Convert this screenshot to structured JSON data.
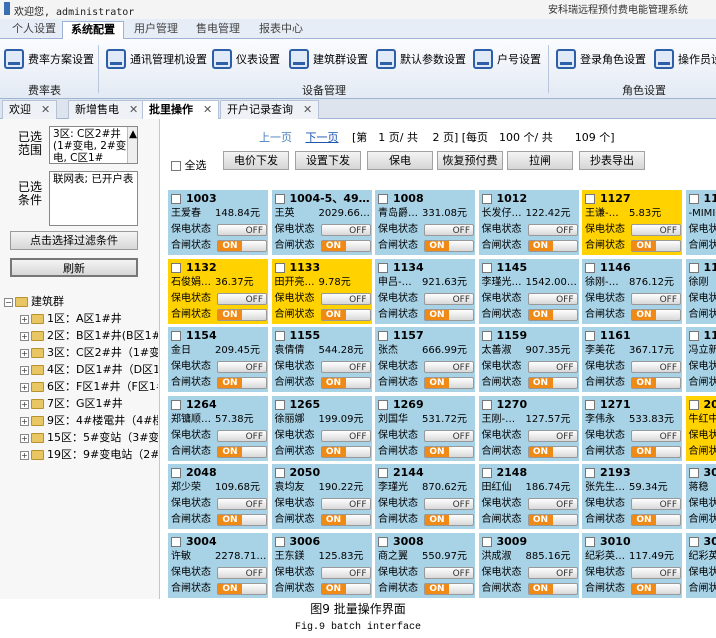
{
  "topbar": {
    "welcome": "欢迎您, administrator",
    "app_title": "安科瑞远程预付费电能管理系统"
  },
  "menu_tabs": [
    "个人设置",
    "系统配置",
    "用户管理",
    "售电管理",
    "报表中心"
  ],
  "active_menu": "系统配置",
  "ribbon": {
    "buttons": [
      "费率方案设置",
      "通讯管理机设置",
      "仪表设置",
      "建筑群设置",
      "默认参数设置",
      "户号设置",
      "登录角色设置",
      "操作员设置"
    ],
    "groups": [
      "费率表",
      "设备管理",
      "角色设置"
    ]
  },
  "doc_tabs": [
    "欢迎",
    "新增售电",
    "批里操作",
    "开户记录查询"
  ],
  "left": {
    "range_label": "已选范围",
    "range_text": "3区: C区2#井 (1#变电, 2#变电, C区1#",
    "cond_label": "已选条件",
    "cond_text": "联网表; 已开户表",
    "filter_button": "点击选择过滤条件",
    "refresh_button": "刷新",
    "tree_root": "建筑群",
    "tree_items": [
      "1区：A区1#井",
      "2区：B区1#井(B区1#井",
      "3区：C区2#井（1#变电",
      "4区：D区1#井（D区1#",
      "6区：F区1#井（F区1#井",
      "7区：G区1#井",
      "9区：4#楼電井（4#楼",
      "15区：5#变站（3#变电",
      "19区：9#变电站（2#楼"
    ]
  },
  "pager": {
    "prev": "上一页",
    "next": "下一页",
    "text": "[第　1 页/ 共　 2 页] [每页　100 个/ 共　　109 个]"
  },
  "select_all": "全选",
  "action_buttons": [
    "电价下发",
    "设置下发",
    "保电",
    "恢复预付费",
    "拉闸",
    "抄表导出"
  ],
  "labels": {
    "power_status": "保电状态",
    "switch_status": "合闸状态",
    "off": "OFF",
    "on": "ON"
  },
  "cards": [
    {
      "id": "1003",
      "name": "王爱春",
      "amount": "148.84元",
      "yellow": false
    },
    {
      "id": "1004-5、49…",
      "name": "王英",
      "amount": "2029.66…",
      "yellow": false
    },
    {
      "id": "1008",
      "name": "青岛爵…",
      "amount": "331.08元",
      "yellow": false
    },
    {
      "id": "1012",
      "name": "长发仔…",
      "amount": "122.42元",
      "yellow": false
    },
    {
      "id": "1127",
      "name": "王谦-…",
      "amount": "5.83元",
      "yellow": true
    },
    {
      "id": "11",
      "name": "-MIMI",
      "amount": "",
      "yellow": false
    },
    {
      "id": "1132",
      "name": "石俊娟…",
      "amount": "36.37元",
      "yellow": true
    },
    {
      "id": "1133",
      "name": "田开亮…",
      "amount": "9.78元",
      "yellow": true
    },
    {
      "id": "1134",
      "name": "申吕-…",
      "amount": "921.63元",
      "yellow": false
    },
    {
      "id": "1145",
      "name": "李瑾光…",
      "amount": "1542.00…",
      "yellow": false
    },
    {
      "id": "1146",
      "name": "徐刚-…",
      "amount": "876.12元",
      "yellow": false
    },
    {
      "id": "11",
      "name": "徐刚",
      "amount": "",
      "yellow": false
    },
    {
      "id": "1154",
      "name": "金日",
      "amount": "209.45元",
      "yellow": false
    },
    {
      "id": "1155",
      "name": "袁倩倩",
      "amount": "544.28元",
      "yellow": false
    },
    {
      "id": "1157",
      "name": "张杰",
      "amount": "666.99元",
      "yellow": false
    },
    {
      "id": "1159",
      "name": "太善淑",
      "amount": "907.35元",
      "yellow": false
    },
    {
      "id": "1161",
      "name": "李美花",
      "amount": "367.17元",
      "yellow": false
    },
    {
      "id": "11",
      "name": "冯立新",
      "amount": "",
      "yellow": false
    },
    {
      "id": "1264",
      "name": "郑镛顺…",
      "amount": "57.38元",
      "yellow": false
    },
    {
      "id": "1265",
      "name": "徐丽娜",
      "amount": "199.09元",
      "yellow": false
    },
    {
      "id": "1269",
      "name": "刘国华",
      "amount": "531.72元",
      "yellow": false
    },
    {
      "id": "1270",
      "name": "王刚-…",
      "amount": "127.57元",
      "yellow": false
    },
    {
      "id": "1271",
      "name": "李伟永",
      "amount": "533.83元",
      "yellow": false
    },
    {
      "id": "20",
      "name": "牛红中",
      "amount": "",
      "yellow": true
    },
    {
      "id": "2048",
      "name": "郑少荣",
      "amount": "109.68元",
      "yellow": false
    },
    {
      "id": "2050",
      "name": "袁均友",
      "amount": "190.22元",
      "yellow": false
    },
    {
      "id": "2144",
      "name": "李瑾光",
      "amount": "870.62元",
      "yellow": false
    },
    {
      "id": "2148",
      "name": "田红仙",
      "amount": "186.74元",
      "yellow": false
    },
    {
      "id": "2193",
      "name": "张先生…",
      "amount": "59.34元",
      "yellow": false
    },
    {
      "id": "30",
      "name": "蒋稳",
      "amount": "",
      "yellow": false
    },
    {
      "id": "3004",
      "name": "许敏",
      "amount": "2278.71…",
      "yellow": false
    },
    {
      "id": "3006",
      "name": "王东鎂",
      "amount": "125.83元",
      "yellow": false
    },
    {
      "id": "3008",
      "name": "商之翼",
      "amount": "550.97元",
      "yellow": false
    },
    {
      "id": "3009",
      "name": "洪成淑",
      "amount": "885.16元",
      "yellow": false
    },
    {
      "id": "3010",
      "name": "纪彩英…",
      "amount": "117.49元",
      "yellow": false
    },
    {
      "id": "30",
      "name": "纪彩英",
      "amount": "",
      "yellow": false
    }
  ],
  "caption_cn": "图9 批量操作界面",
  "caption_en": "Fig.9 batch interface"
}
